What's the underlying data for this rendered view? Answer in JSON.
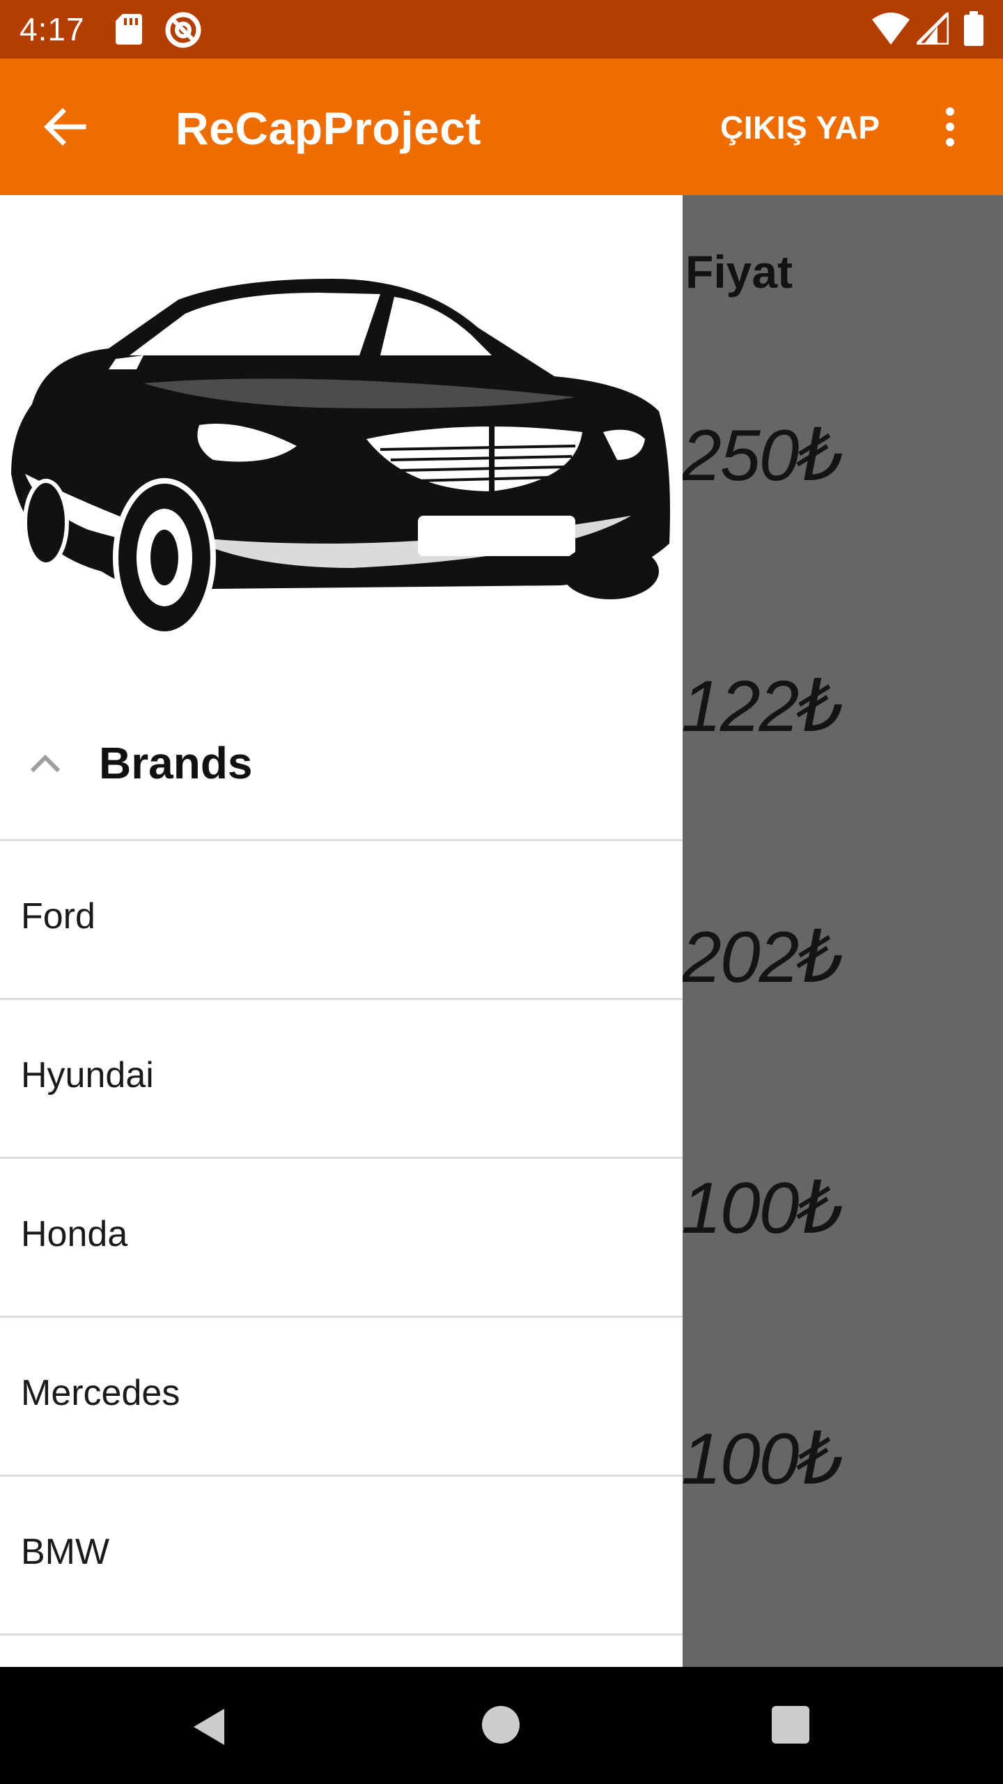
{
  "status_bar": {
    "time": "4:17"
  },
  "app_bar": {
    "title": "ReCapProject",
    "logout_label": "ÇIKIŞ YAP"
  },
  "background_list": {
    "column_header": "Fiyat",
    "prices": [
      "250₺",
      "122₺",
      "202₺",
      "100₺",
      "100₺"
    ]
  },
  "drawer": {
    "section_title": "Brands",
    "brands": [
      "Ford",
      "Hyundai",
      "Honda",
      "Mercedes",
      "BMW"
    ]
  },
  "colors": {
    "status_bar": "#b33e00",
    "app_bar": "#ef6c00",
    "scrim": "#666666"
  }
}
